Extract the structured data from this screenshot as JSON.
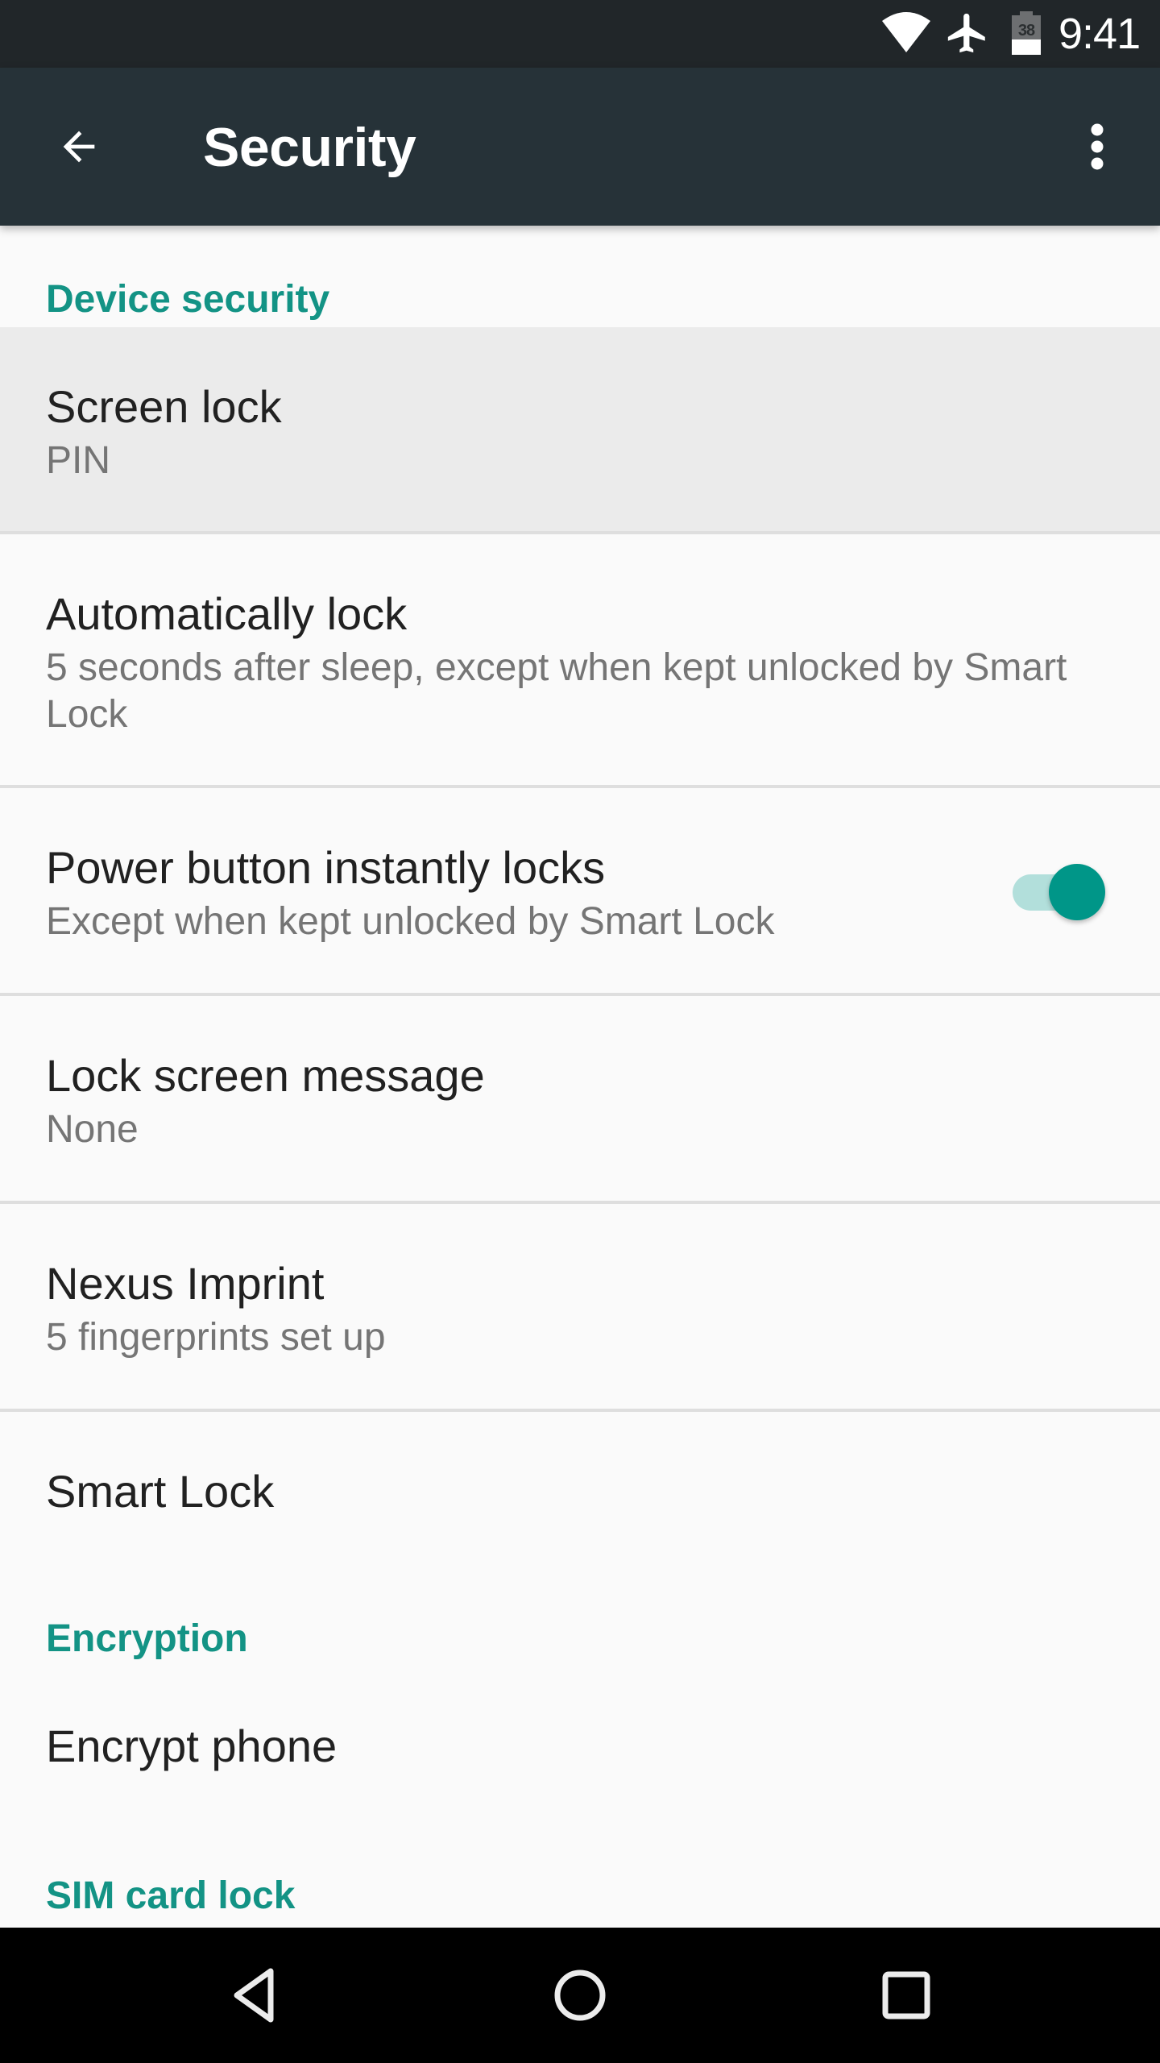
{
  "status_bar": {
    "time": "9:41",
    "battery_level": "38",
    "battery_fraction": 0.38,
    "icons": [
      "wifi-icon",
      "airplane-mode-icon",
      "battery-icon"
    ]
  },
  "toolbar": {
    "title": "Security",
    "back_icon": "arrow-back-icon",
    "overflow_icon": "more-vert-icon"
  },
  "sections": {
    "device_security": {
      "header": "Device security",
      "items": [
        {
          "title": "Screen lock",
          "summary": "PIN",
          "highlighted": true
        },
        {
          "title": "Automatically lock",
          "summary": "5 seconds after sleep, except when kept unlocked by Smart Lock"
        },
        {
          "title": "Power button instantly locks",
          "summary": "Except when kept unlocked by Smart Lock",
          "toggle": true,
          "checked": true
        },
        {
          "title": "Lock screen message",
          "summary": "None"
        },
        {
          "title": "Nexus Imprint",
          "summary": "5 fingerprints set up"
        },
        {
          "title": "Smart Lock"
        }
      ]
    },
    "encryption": {
      "header": "Encryption",
      "items": [
        {
          "title": "Encrypt phone"
        }
      ]
    },
    "sim_card_lock": {
      "header": "SIM card lock"
    }
  },
  "nav_bar": {
    "buttons": [
      "back-icon",
      "home-icon",
      "recents-icon"
    ]
  },
  "colors": {
    "accent": "#009688",
    "section_header": "#139385",
    "toolbar": "#263238",
    "status_bar": "#212629",
    "switch_track": "#b2dfdb",
    "background": "#fafafa",
    "highlight": "#ebebeb"
  }
}
